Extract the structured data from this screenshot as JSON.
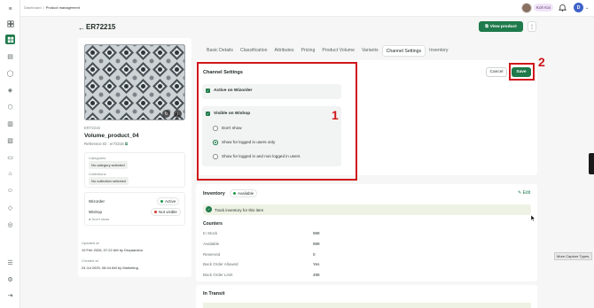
{
  "breadcrumb": [
    "Dashboard",
    "Product management"
  ],
  "user": {
    "name": "Koh Kai",
    "initial": "D"
  },
  "page": {
    "title": "ER72215",
    "view_product": "View product"
  },
  "product": {
    "sku": "ER72215",
    "name": "Volume_product_04",
    "reference": "Reference ID : er72215",
    "categories_label": "Categories",
    "categories_value": "No category selected",
    "collections_label": "Collections",
    "collections_value": "No collection selected",
    "channels": [
      {
        "name": "Wizorder",
        "status": "Active",
        "color": "#1e9a4a"
      },
      {
        "name": "Wishop",
        "status": "Not visible",
        "color": "#d13a2e",
        "sub": "Don't show"
      }
    ],
    "updated_label": "Updated at",
    "updated_value": "19 Feb 2026, 07:22 AM by Divyaanshu",
    "created_label": "Created at",
    "created_value": "24 Jul 2025, 08:44 AM by Marketing"
  },
  "tabs": [
    "Basic Details",
    "Classification",
    "Attributes",
    "Pricing",
    "Product Volume",
    "Variants",
    "Channel Settings",
    "Inventory"
  ],
  "channel_settings": {
    "title": "Channel Settings",
    "cancel": "Cancel",
    "save": "Save",
    "wizorder_label": "Active on Wizorder",
    "wishop_label": "Visible on Wishop",
    "options": [
      "Don't show",
      "Show for logged in users only",
      "Show for logged in and non logged in users"
    ],
    "selected_index": 1
  },
  "annotations": {
    "one": "1",
    "two": "2"
  },
  "inventory": {
    "title": "Inventory",
    "status": "Available",
    "edit": "Edit",
    "track": "Track inventory for this item",
    "counters_title": "Counters",
    "counters": [
      {
        "label": "In Stock",
        "value": "989"
      },
      {
        "label": "Available",
        "value": "989"
      },
      {
        "label": "Reserved",
        "value": "0"
      },
      {
        "label": "Back Order Allowed",
        "value": "Yes"
      },
      {
        "label": "Back Order Limit",
        "value": "498"
      }
    ]
  },
  "in_transit": {
    "title": "In Transit"
  },
  "capture_tip": "More Capture Types."
}
